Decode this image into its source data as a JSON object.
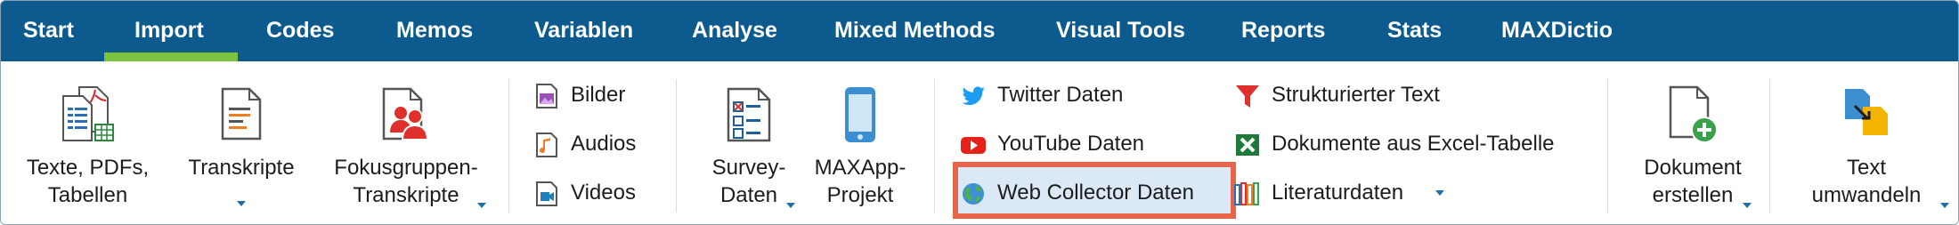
{
  "tabs": [
    {
      "label": "Start"
    },
    {
      "label": "Import",
      "active": true
    },
    {
      "label": "Codes"
    },
    {
      "label": "Memos"
    },
    {
      "label": "Variablen"
    },
    {
      "label": "Analyse"
    },
    {
      "label": "Mixed Methods"
    },
    {
      "label": "Visual Tools"
    },
    {
      "label": "Reports"
    },
    {
      "label": "Stats"
    },
    {
      "label": "MAXDictio"
    }
  ],
  "ribbon": {
    "texte": {
      "line1": "Texte, PDFs,",
      "line2": "Tabellen"
    },
    "transkripte": {
      "line1": "Transkripte"
    },
    "fokus": {
      "line1": "Fokusgruppen-",
      "line2": "Transkripte"
    },
    "bilder": "Bilder",
    "audios": "Audios",
    "videos": "Videos",
    "survey": {
      "line1": "Survey-",
      "line2": "Daten"
    },
    "maxapp": {
      "line1": "MAXApp-",
      "line2": "Projekt"
    },
    "twitter": "Twitter Daten",
    "youtube": "YouTube Daten",
    "webcollector": "Web Collector Daten",
    "strukturiert": "Strukturierter Text",
    "excel": "Dokumente aus Excel-Tabelle",
    "literatur": "Literaturdaten",
    "dokument": {
      "line1": "Dokument",
      "line2": "erstellen"
    },
    "textumwandeln": {
      "line1": "Text",
      "line2": "umwandeln"
    }
  },
  "colors": {
    "tabbar": "#0d5b8e",
    "active_underline": "#7cc33f",
    "highlight_border": "#e8644a",
    "highlight_fill": "#dbe9f6"
  }
}
